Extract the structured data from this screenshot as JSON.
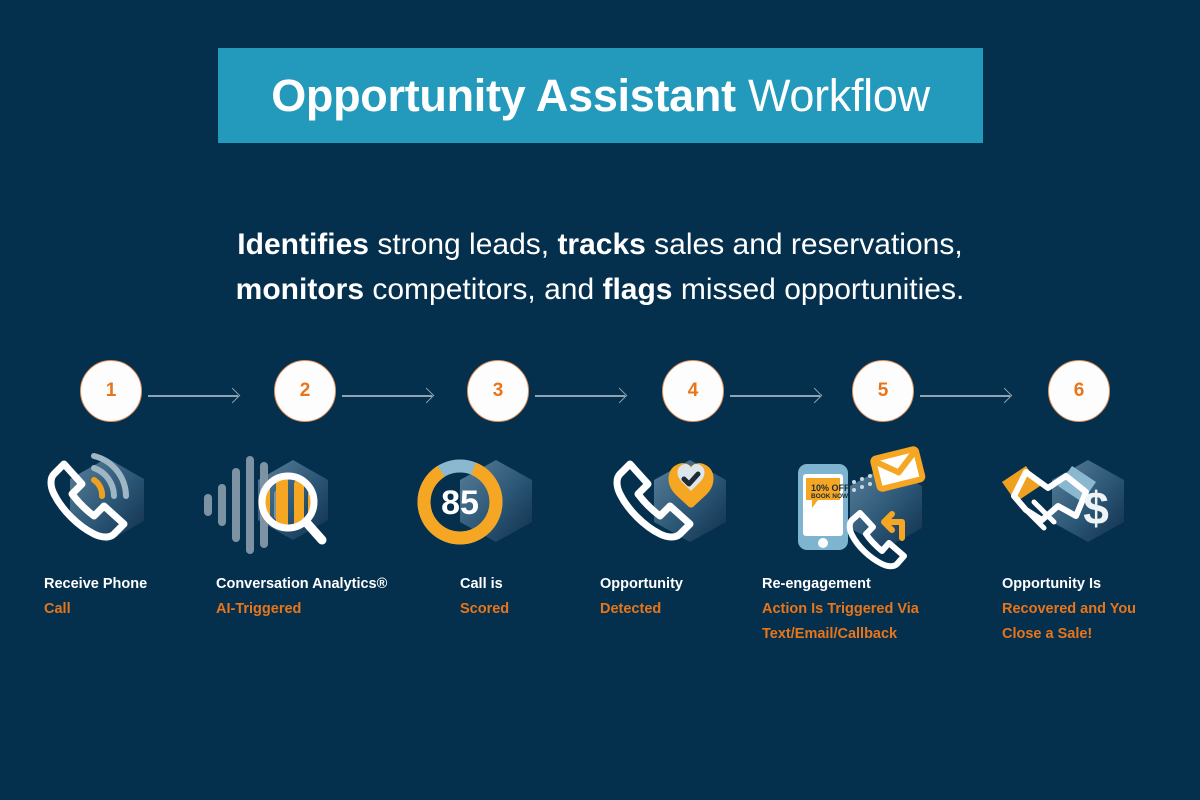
{
  "banner": {
    "title_bold": "Opportunity Assistant",
    "title_normal": " Workflow"
  },
  "subtitle": {
    "line1_part1": "Identifies",
    "line1_part2": " strong leads, ",
    "line1_part3": "tracks",
    "line1_part4": " sales and reservations,",
    "line2_part1": "monitors",
    "line2_part2": " competitors, and ",
    "line2_part3": "flags",
    "line2_part4": " missed opportunities."
  },
  "colors": {
    "background": "#05304d",
    "banner_teal": "#2399bb",
    "accent_orange": "#e8751a",
    "white": "#ffffff",
    "arrow_gray": "#8fa3b0",
    "hex_light": "#4f7790",
    "hex_dark": "#123a5a"
  },
  "steps": [
    {
      "number": "1",
      "icon": "phone-ring-icon",
      "title": "Receive Phone",
      "accent": "Call"
    },
    {
      "number": "2",
      "icon": "waveform-search-icon",
      "title": "Conversation Analytics®",
      "accent": "AI-Triggered"
    },
    {
      "number": "3",
      "icon": "score-gauge-icon",
      "title": "Call is",
      "accent": "Scored"
    },
    {
      "number": "4",
      "icon": "phone-heart-check-icon",
      "title": "Opportunity",
      "accent": "Detected"
    },
    {
      "number": "5",
      "icon": "reengagement-icon",
      "title": "Re-engagement",
      "accent": "Action Is Triggered Via",
      "accent2": "Text/Email/Callback"
    },
    {
      "number": "6",
      "icon": "handshake-dollar-icon",
      "title": "Opportunity Is",
      "accent": "Recovered and You",
      "accent2": "Close a Sale!"
    }
  ],
  "icon_details": {
    "score_gauge_value": "85",
    "promo_offer": "10% OFF",
    "promo_cta": "BOOK NOW",
    "currency_symbol": "$"
  }
}
